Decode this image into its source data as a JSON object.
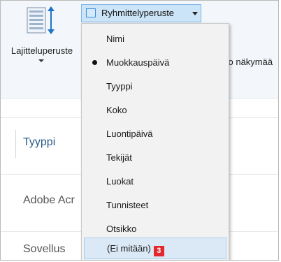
{
  "ribbon": {
    "sort_label": "Lajitteluperuste",
    "view_fragment": "ko näkymää",
    "group_by_label": "Ryhmittelyperuste"
  },
  "list": {
    "row1": "Tyyppi",
    "row2": "Adobe Acr",
    "row3": "Sovellus"
  },
  "menu": {
    "items": [
      {
        "label": "Nimi",
        "selected": false
      },
      {
        "label": "Muokkauspäivä",
        "selected": true
      },
      {
        "label": "Tyyppi",
        "selected": false
      },
      {
        "label": "Koko",
        "selected": false
      },
      {
        "label": "Luontipäivä",
        "selected": false
      },
      {
        "label": "Tekijät",
        "selected": false
      },
      {
        "label": "Luokat",
        "selected": false
      },
      {
        "label": "Tunnisteet",
        "selected": false
      },
      {
        "label": "Otsikko",
        "selected": false
      },
      {
        "label": "(Ei mitään)",
        "selected": false,
        "highlighted": true
      }
    ],
    "badge": "3"
  },
  "colors": {
    "accent": "#3b8ddd",
    "highlight_bg": "#dbe9f7",
    "badge_red": "#e2282d"
  }
}
